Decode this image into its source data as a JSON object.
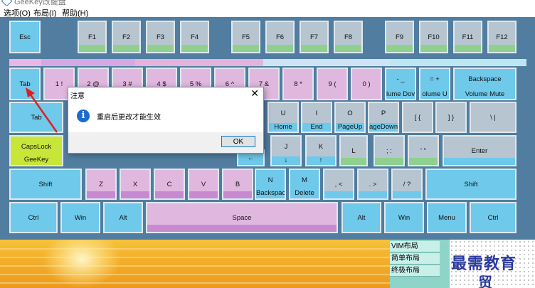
{
  "window": {
    "title": "GeeKey改键盘"
  },
  "menu": [
    {
      "label": "选项(O)"
    },
    {
      "label": "布局(I)"
    },
    {
      "label": "帮助(H)"
    }
  ],
  "keys": {
    "esc": "Esc",
    "f1": "F1",
    "f2": "F2",
    "f3": "F3",
    "f4": "F4",
    "f5": "F5",
    "f6": "F6",
    "f7": "F7",
    "f8": "F8",
    "f9": "F9",
    "f10": "F10",
    "f11": "F11",
    "f12": "F12",
    "tab_top": "Tab",
    "n1": "1 !",
    "n2": "2 @",
    "n3": "3 #",
    "n4": "4 $",
    "n5": "5 %",
    "n6": "6 ^",
    "n7": "7 &",
    "n8": "8 *",
    "n9": "9 (",
    "n0": "0 )",
    "minus": "- _",
    "minus_sub": "lume Dov",
    "plus": "= +",
    "plus_sub": "olume U",
    "backspace": "Backspace",
    "backspace_sub": "Volume Mute",
    "tab": "Tab",
    "u": "U",
    "u_sub": "Home",
    "i": "I",
    "i_sub": "End",
    "o": "O",
    "o_sub": "PageUp",
    "p": "P",
    "p_sub": "ageDown",
    "lbracket": "[ {",
    "rbracket": "] }",
    "backslash": "\\ |",
    "capslock": "CapsLock",
    "capslock_sub": "GeeKey",
    "j": "J",
    "j_sub": "↓",
    "k": "K",
    "k_sub": "↑",
    "l": "L",
    "semicolon": "; :",
    "quote": "' \"",
    "enter": "Enter",
    "left_arrow": "←",
    "shift_left": "Shift",
    "z": "Z",
    "x": "X",
    "c": "C",
    "v": "V",
    "b": "B",
    "n": "N",
    "n_sub": "Backspace",
    "m": "M",
    "m_sub": "Delete",
    "comma": ", <",
    "period": ". >",
    "slash": "/ ?",
    "shift_right": "Shift",
    "ctrl_left": "Ctrl",
    "win_left": "Win",
    "alt_left": "Alt",
    "space": "Space",
    "alt_right": "Alt",
    "win_right": "Win",
    "menu": "Menu",
    "ctrl_right": "Ctrl"
  },
  "dialog": {
    "title": "注意",
    "message": "重启后更改才能生效",
    "ok": "OK",
    "close": "✕"
  },
  "layouts": [
    {
      "label": "VIM布局"
    },
    {
      "label": "简单布局"
    },
    {
      "label": "终极布局"
    }
  ],
  "watermark": {
    "line1": "最需教育",
    "line2": "贸"
  },
  "colors": {
    "key_blue": "#6ec9ea",
    "key_grey": "#b7c5d1",
    "key_purple": "#e0b8df",
    "key_lime": "#c8e53a",
    "strip_green": "#8fd08f",
    "strip_blue": "#6ec9ea",
    "strip_purple": "#c78ad0",
    "accent": "#0078d7"
  }
}
